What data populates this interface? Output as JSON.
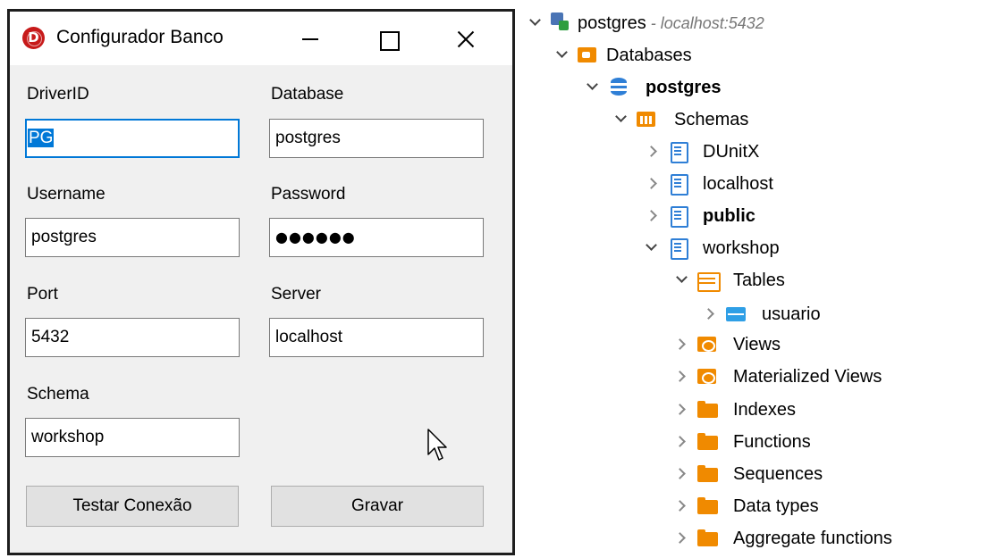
{
  "window": {
    "title": "Configurador Banco",
    "icon_letter": "D"
  },
  "form": {
    "driver_label": "DriverID",
    "driver_value": "PG",
    "database_label": "Database",
    "database_value": "postgres",
    "username_label": "Username",
    "username_value": "postgres",
    "password_label": "Password",
    "password_value": "●●●●●●",
    "port_label": "Port",
    "port_value": "5432",
    "server_label": "Server",
    "server_value": "localhost",
    "schema_label": "Schema",
    "schema_value": "workshop",
    "test_button": "Testar Conexão",
    "save_button": "Gravar"
  },
  "tree": {
    "server": {
      "label": "postgres",
      "extra": " - localhost:5432"
    },
    "databases": "Databases",
    "database": "postgres",
    "schemas": "Schemas",
    "schema_items": [
      "DUnitX",
      "localhost",
      "public",
      "workshop"
    ],
    "tables": "Tables",
    "table_items": [
      "usuario"
    ],
    "objects": [
      "Views",
      "Materialized Views",
      "Indexes",
      "Functions",
      "Sequences",
      "Data types",
      "Aggregate functions"
    ]
  },
  "colors": {
    "accent": "#0078d7",
    "folder_orange": "#f08a00",
    "db_blue": "#2f7fd6"
  }
}
